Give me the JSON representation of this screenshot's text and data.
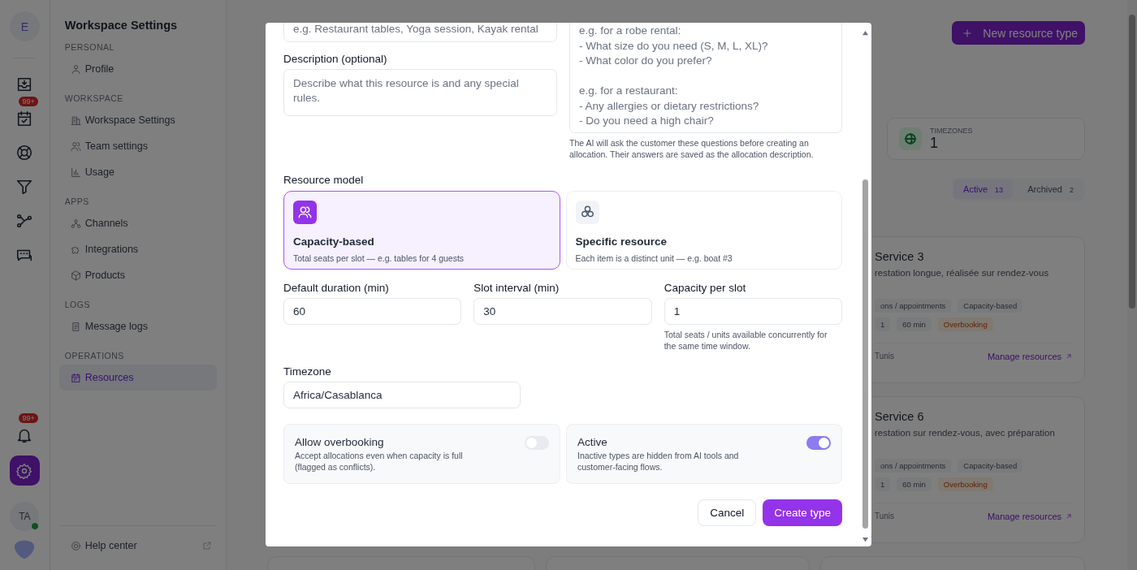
{
  "rail": {
    "avatar": "E",
    "calendar_badge": "99+",
    "bell_badge": "99+",
    "user": "TA",
    "online": true
  },
  "sidebar": {
    "title": "Workspace Settings",
    "sections": [
      {
        "heading": "PERSONAL",
        "items": [
          {
            "label": "Profile",
            "selected": false
          }
        ]
      },
      {
        "heading": "WORKSPACE",
        "items": [
          {
            "label": "Workspace Settings",
            "selected": false
          },
          {
            "label": "Team settings",
            "selected": false
          },
          {
            "label": "Usage",
            "selected": false
          }
        ]
      },
      {
        "heading": "APPS",
        "items": [
          {
            "label": "Channels",
            "selected": false
          },
          {
            "label": "Integrations",
            "selected": false
          },
          {
            "label": "Products",
            "selected": false
          }
        ]
      },
      {
        "heading": "LOGS",
        "items": [
          {
            "label": "Message logs",
            "selected": false
          }
        ]
      },
      {
        "heading": "OPERATIONS",
        "items": [
          {
            "label": "Resources",
            "selected": true
          }
        ]
      }
    ],
    "footer": "Help center"
  },
  "main": {
    "new_button": "New resource type",
    "stat": {
      "label": "TIMEZONES",
      "value": "1"
    },
    "tabs": [
      {
        "label": "Active",
        "count": "13",
        "selected": true
      },
      {
        "label": "Archived",
        "count": "2",
        "selected": false
      }
    ],
    "cards": [
      {
        "title": "Service 3",
        "description": "restation longue, réalisée sur rendez-vous",
        "tag_rows": [
          [
            {
              "label": "ons / appointments",
              "kind": "plain"
            },
            {
              "label": "Capacity-based",
              "kind": "plain"
            }
          ],
          [
            {
              "label": "1",
              "kind": "plain"
            },
            {
              "label": "60 min",
              "kind": "plain"
            },
            {
              "label": "Overbooking",
              "kind": "warning"
            }
          ]
        ],
        "footer": "Tunis",
        "link": "Manage resources"
      },
      {
        "title": "Service 6",
        "description": "restation sur rendez-vous, avec préparation",
        "tag_rows": [
          [
            {
              "label": "ons / appointments",
              "kind": "plain"
            },
            {
              "label": "Capacity-based",
              "kind": "plain"
            }
          ],
          [
            {
              "label": "1",
              "kind": "plain"
            },
            {
              "label": "60 min",
              "kind": "plain"
            },
            {
              "label": "Overbooking",
              "kind": "warning"
            }
          ]
        ],
        "footer": "Tunis",
        "link": "Manage resources"
      }
    ]
  },
  "modal": {
    "name_field": {
      "placeholder": "e.g. Restaurant tables, Yoga session, Kayak rental"
    },
    "description": {
      "label": "Description (optional)",
      "placeholder": "Describe what this resource is and any special rules."
    },
    "questions": {
      "placeholder": "e.g. for a robe rental:\n- What size do you need (S, M, L, XL)?\n- What color do you prefer?\n\ne.g. for a restaurant:\n- Any allergies or dietary restrictions?\n- Do you need a high chair?",
      "hint": "The AI will ask the customer these questions before creating an allocation. Their answers are saved as the allocation description."
    },
    "resource_model": {
      "label": "Resource model",
      "options": [
        {
          "title": "Capacity-based",
          "description": "Total seats per slot — e.g. tables for 4 guests",
          "selected": true
        },
        {
          "title": "Specific resource",
          "description": "Each item is a distinct unit — e.g. boat #3",
          "selected": false
        }
      ]
    },
    "fields": [
      {
        "label": "Default duration (min)",
        "value": "60"
      },
      {
        "label": "Slot interval (min)",
        "value": "30"
      },
      {
        "label": "Capacity per slot",
        "value": "1",
        "hint": "Total seats / units available concurrently for the same time window."
      }
    ],
    "timezone": {
      "label": "Timezone",
      "value": "Africa/Casablanca"
    },
    "toggles": [
      {
        "title": "Allow overbooking",
        "description": "Accept allocations even when capacity is full (flagged as conflicts).",
        "on": false
      },
      {
        "title": "Active",
        "description": "Inactive types are hidden from AI tools and customer-facing flows.",
        "on": true
      }
    ],
    "buttons": [
      {
        "label": "Cancel",
        "kind": "secondary"
      },
      {
        "label": "Create type",
        "kind": "primary"
      }
    ]
  }
}
